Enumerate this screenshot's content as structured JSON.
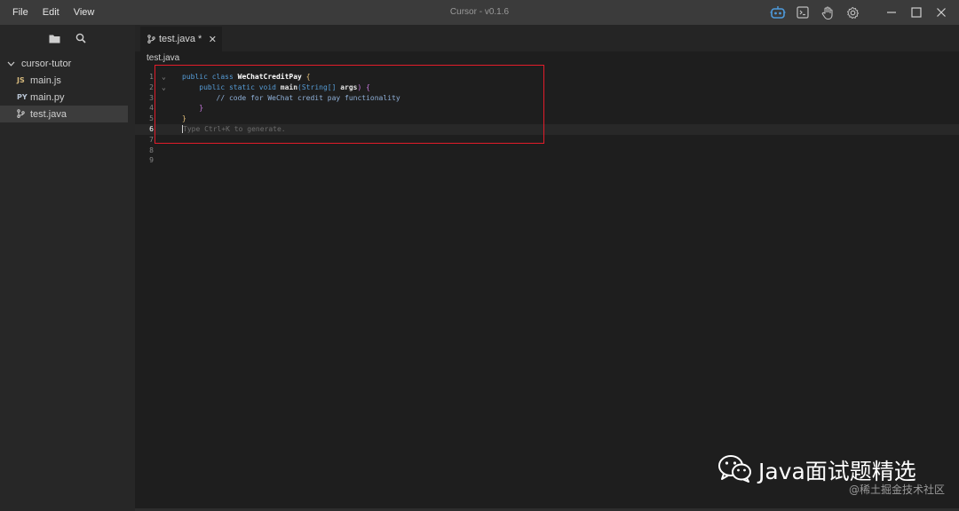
{
  "menu": {
    "file": "File",
    "edit": "Edit",
    "view": "View"
  },
  "app_title": "Cursor - v0.1.6",
  "sidebar": {
    "folder": "cursor-tutor",
    "files": [
      {
        "type": "JS",
        "name": "main.js",
        "type_color": "#d7ba7d"
      },
      {
        "type": "PY",
        "name": "main.py",
        "type_color": "#b7c3d3"
      },
      {
        "type": "git",
        "name": "test.java"
      }
    ]
  },
  "tab": {
    "label": "test.java *",
    "close": "✕"
  },
  "breadcrumb": "test.java",
  "editor": {
    "line_numbers": [
      "1",
      "2",
      "3",
      "4",
      "5",
      "6",
      "7",
      "8",
      "9"
    ],
    "current_line": 6,
    "code": {
      "l1_kw": "public class ",
      "l1_cls": "WeChatCreditPay",
      "l1_br": " {",
      "l2_kw1": "public static void ",
      "l2_fn": "main",
      "l2_params": "(String[] ",
      "l2_arg": "args",
      "l2_end": ") {",
      "l3_comment": "// code for WeChat credit pay functionality",
      "l4_close": "}",
      "l5_close": "}",
      "l6_placeholder": "Type Ctrl+K to generate."
    }
  },
  "watermark": {
    "title": "Java面试题精选",
    "sub": "@稀土掘金技术社区"
  },
  "colors": {
    "highlight_box": "#e21c2a",
    "accent": "#569cd6"
  }
}
